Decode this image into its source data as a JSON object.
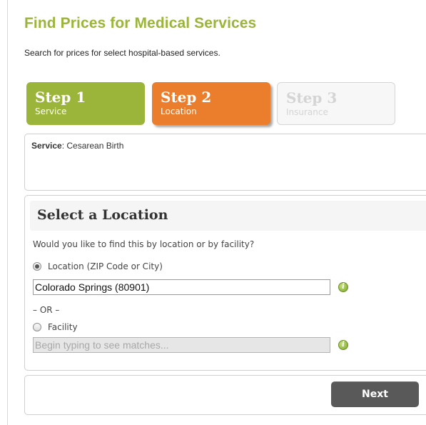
{
  "page": {
    "title": "Find Prices for Medical Services",
    "subtitle": "Search for prices for select hospital-based services."
  },
  "steps": [
    {
      "number": "Step 1",
      "label": "Service",
      "state": "complete",
      "color": "#9bb43a"
    },
    {
      "number": "Step 2",
      "label": "Location",
      "state": "active",
      "color": "#ea7e2d"
    },
    {
      "number": "Step 3",
      "label": "Insurance",
      "state": "disabled",
      "color": "#f7f7f7"
    }
  ],
  "service": {
    "label": "Service",
    "value": ": Cesarean Birth"
  },
  "location_section": {
    "heading": "Select a Location",
    "question": "Would you like to find this by location or by facility?",
    "location_option": {
      "label": "Location (ZIP Code or City)",
      "selected": true,
      "value": "Colorado Springs (80901)"
    },
    "or_text": "– OR –",
    "facility_option": {
      "label": "Facility",
      "selected": false,
      "placeholder": "Begin typing to see matches..."
    }
  },
  "icons": {
    "help": "info-icon"
  },
  "nav": {
    "next_label": "Next"
  }
}
